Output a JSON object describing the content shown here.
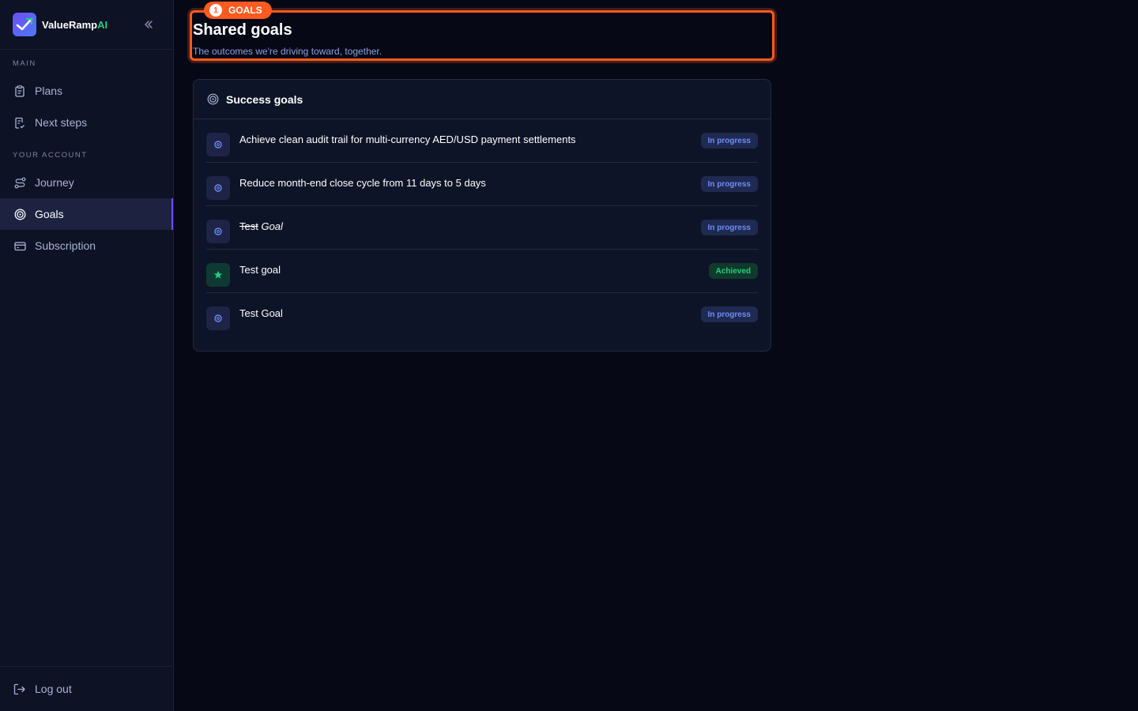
{
  "brand": {
    "name_main": "ValueRamp",
    "name_accent": "AI"
  },
  "sidebar": {
    "main_label": "MAIN",
    "account_label": "YOUR ACCOUNT",
    "items": [
      {
        "label": "Plans",
        "icon": "clipboard-icon"
      },
      {
        "label": "Next steps",
        "icon": "checklist-icon"
      },
      {
        "label": "Journey",
        "icon": "route-icon"
      },
      {
        "label": "Goals",
        "icon": "target-icon",
        "active": true
      },
      {
        "label": "Subscription",
        "icon": "credit-card-icon"
      }
    ],
    "logout_label": "Log out"
  },
  "header": {
    "badge_number": "1",
    "badge_label": "GOALS",
    "title": "Shared goals",
    "subtitle": "The outcomes we're driving toward, together."
  },
  "card": {
    "title": "Success goals",
    "goals": [
      {
        "text": "Achieve clean audit trail for multi-currency AED/USD payment settlements",
        "status": "In progress"
      },
      {
        "text": "Reduce month-end close cycle from 11 days to 5 days",
        "status": "In progress"
      },
      {
        "text_strike": "Test",
        "text_italic": "Goal",
        "status": "In progress"
      },
      {
        "text": "Test goal",
        "status": "Achieved"
      },
      {
        "text": "Test Goal",
        "status": "In progress"
      }
    ]
  },
  "colors": {
    "accent": "#6d4cf5",
    "highlight": "#ff5a1f",
    "achieved": "#22d07a",
    "in_progress": "#6f8cf7"
  }
}
